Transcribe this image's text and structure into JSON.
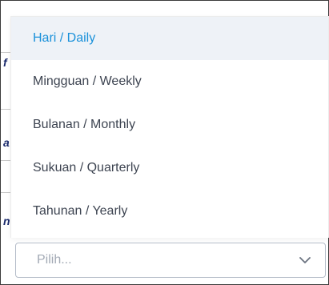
{
  "dropdown": {
    "options": [
      {
        "label": "Hari / Daily",
        "active": true
      },
      {
        "label": "Mingguan / Weekly",
        "active": false
      },
      {
        "label": "Bulanan / Monthly",
        "active": false
      },
      {
        "label": "Sukuan / Quarterly",
        "active": false
      },
      {
        "label": "Tahunan / Yearly",
        "active": false
      }
    ]
  },
  "select": {
    "placeholder": "Pilih...",
    "icon": "chevron-down-icon"
  },
  "background": {
    "fragments": [
      "f",
      "a",
      "n"
    ]
  },
  "colors": {
    "active_text": "#1a91da",
    "active_bg": "#eef2f7",
    "option_text": "#3d4451",
    "placeholder_text": "#a3aab5",
    "select_border": "#b4bcc8"
  }
}
